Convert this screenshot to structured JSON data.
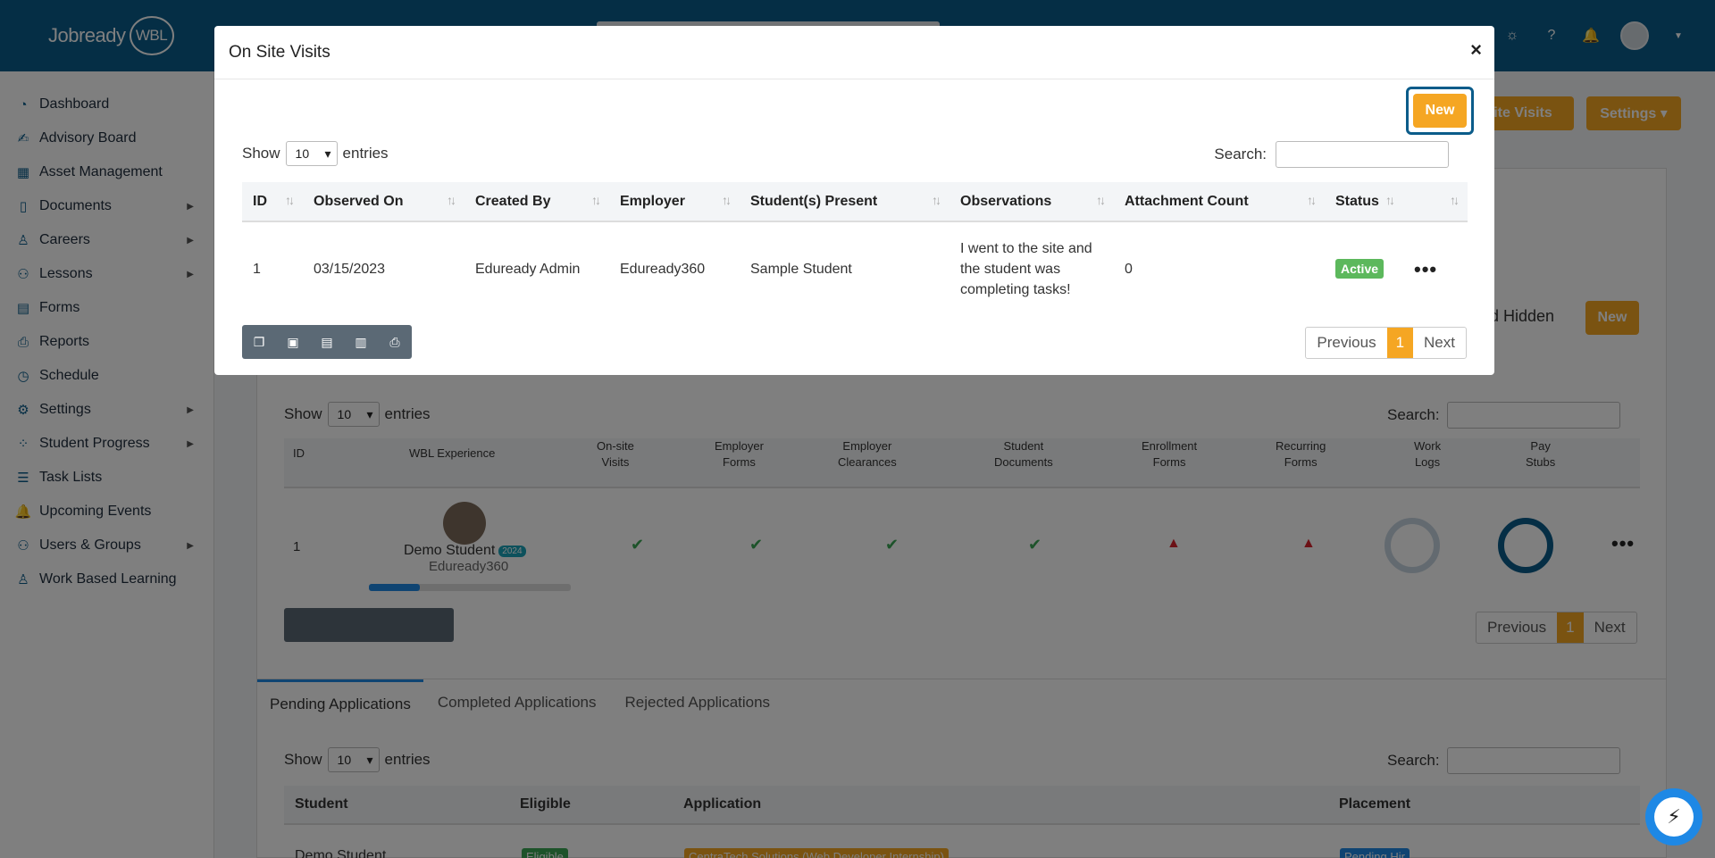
{
  "app": {
    "logo_text": "Jobready",
    "logo_badge": "WBL"
  },
  "sidebar": {
    "items": [
      {
        "label": "Dashboard",
        "icon": "gauge-icon",
        "glyph": "◔",
        "arrow": ""
      },
      {
        "label": "Advisory Board",
        "icon": "signature-icon",
        "glyph": "✍",
        "arrow": ""
      },
      {
        "label": "Asset Management",
        "icon": "barcode-icon",
        "glyph": "▦",
        "arrow": ""
      },
      {
        "label": "Documents",
        "icon": "file-icon",
        "glyph": "▯",
        "arrow": "▶"
      },
      {
        "label": "Careers",
        "icon": "user-tie-icon",
        "glyph": "♙",
        "arrow": "▶"
      },
      {
        "label": "Lessons",
        "icon": "group-icon",
        "glyph": "⚇",
        "arrow": "▶"
      },
      {
        "label": "Forms",
        "icon": "form-icon",
        "glyph": "▤",
        "arrow": ""
      },
      {
        "label": "Reports",
        "icon": "print-icon",
        "glyph": "⎙",
        "arrow": ""
      },
      {
        "label": "Schedule",
        "icon": "clock-icon",
        "glyph": "◷",
        "arrow": ""
      },
      {
        "label": "Settings",
        "icon": "cogs-icon",
        "glyph": "⚙",
        "arrow": "▶"
      },
      {
        "label": "Student Progress",
        "icon": "spinner-icon",
        "glyph": "⁘",
        "arrow": "▶"
      },
      {
        "label": "Task Lists",
        "icon": "list-icon",
        "glyph": "☰",
        "arrow": ""
      },
      {
        "label": "Upcoming Events",
        "icon": "bell-icon",
        "glyph": "🔔",
        "arrow": ""
      },
      {
        "label": "Users & Groups",
        "icon": "users-icon",
        "glyph": "⚇",
        "arrow": "▶"
      },
      {
        "label": "Work Based Learning",
        "icon": "user-icon",
        "glyph": "♙",
        "arrow": ""
      }
    ]
  },
  "background": {
    "top_buttons": {
      "onsite": "-Site Visits",
      "settings": "Settings ▾"
    },
    "hidden_label": "d Hidden",
    "new_label": "New",
    "show_label": "Show",
    "entries_label": "entries",
    "select_value": "10",
    "search_label": "Search:",
    "columns": [
      {
        "l1": "ID",
        "l2": ""
      },
      {
        "l1": "WBL Experience",
        "l2": ""
      },
      {
        "l1": "On-site",
        "l2": "Visits"
      },
      {
        "l1": "Employer",
        "l2": "Forms"
      },
      {
        "l1": "Employer",
        "l2": "Clearances"
      },
      {
        "l1": "Student",
        "l2": "Documents"
      },
      {
        "l1": "Enrollment",
        "l2": "Forms"
      },
      {
        "l1": "Recurring",
        "l2": "Forms"
      },
      {
        "l1": "Work",
        "l2": "Logs"
      },
      {
        "l1": "Pay",
        "l2": "Stubs"
      }
    ],
    "row": {
      "id": "1",
      "student": "Demo Student",
      "year": "2024",
      "employer": "Eduready360"
    },
    "progress": 0.25,
    "pager": {
      "prev": "Previous",
      "page": "1",
      "next": "Next"
    },
    "tabs": [
      "Pending Applications",
      "Completed Applications",
      "Rejected Applications"
    ],
    "app_columns": [
      "Student",
      "Eligible",
      "Application",
      "Placement"
    ],
    "app_row": {
      "student": "Demo Student",
      "eligible": "Eligible",
      "application": "CentraTech Solutions (Web Developer Internship)",
      "placement": "Pending Hir"
    }
  },
  "modal": {
    "title": "On Site Visits",
    "close": "×",
    "new_label": "New",
    "show_label": "Show",
    "entries_label": "entries",
    "select_value": "10",
    "search_label": "Search:",
    "columns": [
      "ID",
      "Observed On",
      "Created By",
      "Employer",
      "Student(s) Present",
      "Observations",
      "Attachment Count",
      "Status",
      ""
    ],
    "rows": [
      {
        "id": "1",
        "observed_on": "03/15/2023",
        "created_by": "Eduready Admin",
        "employer": "Eduready360",
        "students": "Sample Student",
        "observations": "I went to the site and the student was completing tasks!",
        "attachments": "0",
        "status": "Active",
        "actions": "•••"
      }
    ],
    "pager": {
      "prev": "Previous",
      "page": "1",
      "next": "Next"
    }
  },
  "colors": {
    "topbar": "#0b5c8a",
    "accent": "#f5a623",
    "active": "#5cb85c",
    "overlay": "rgba(0,0,0,0.5)"
  }
}
